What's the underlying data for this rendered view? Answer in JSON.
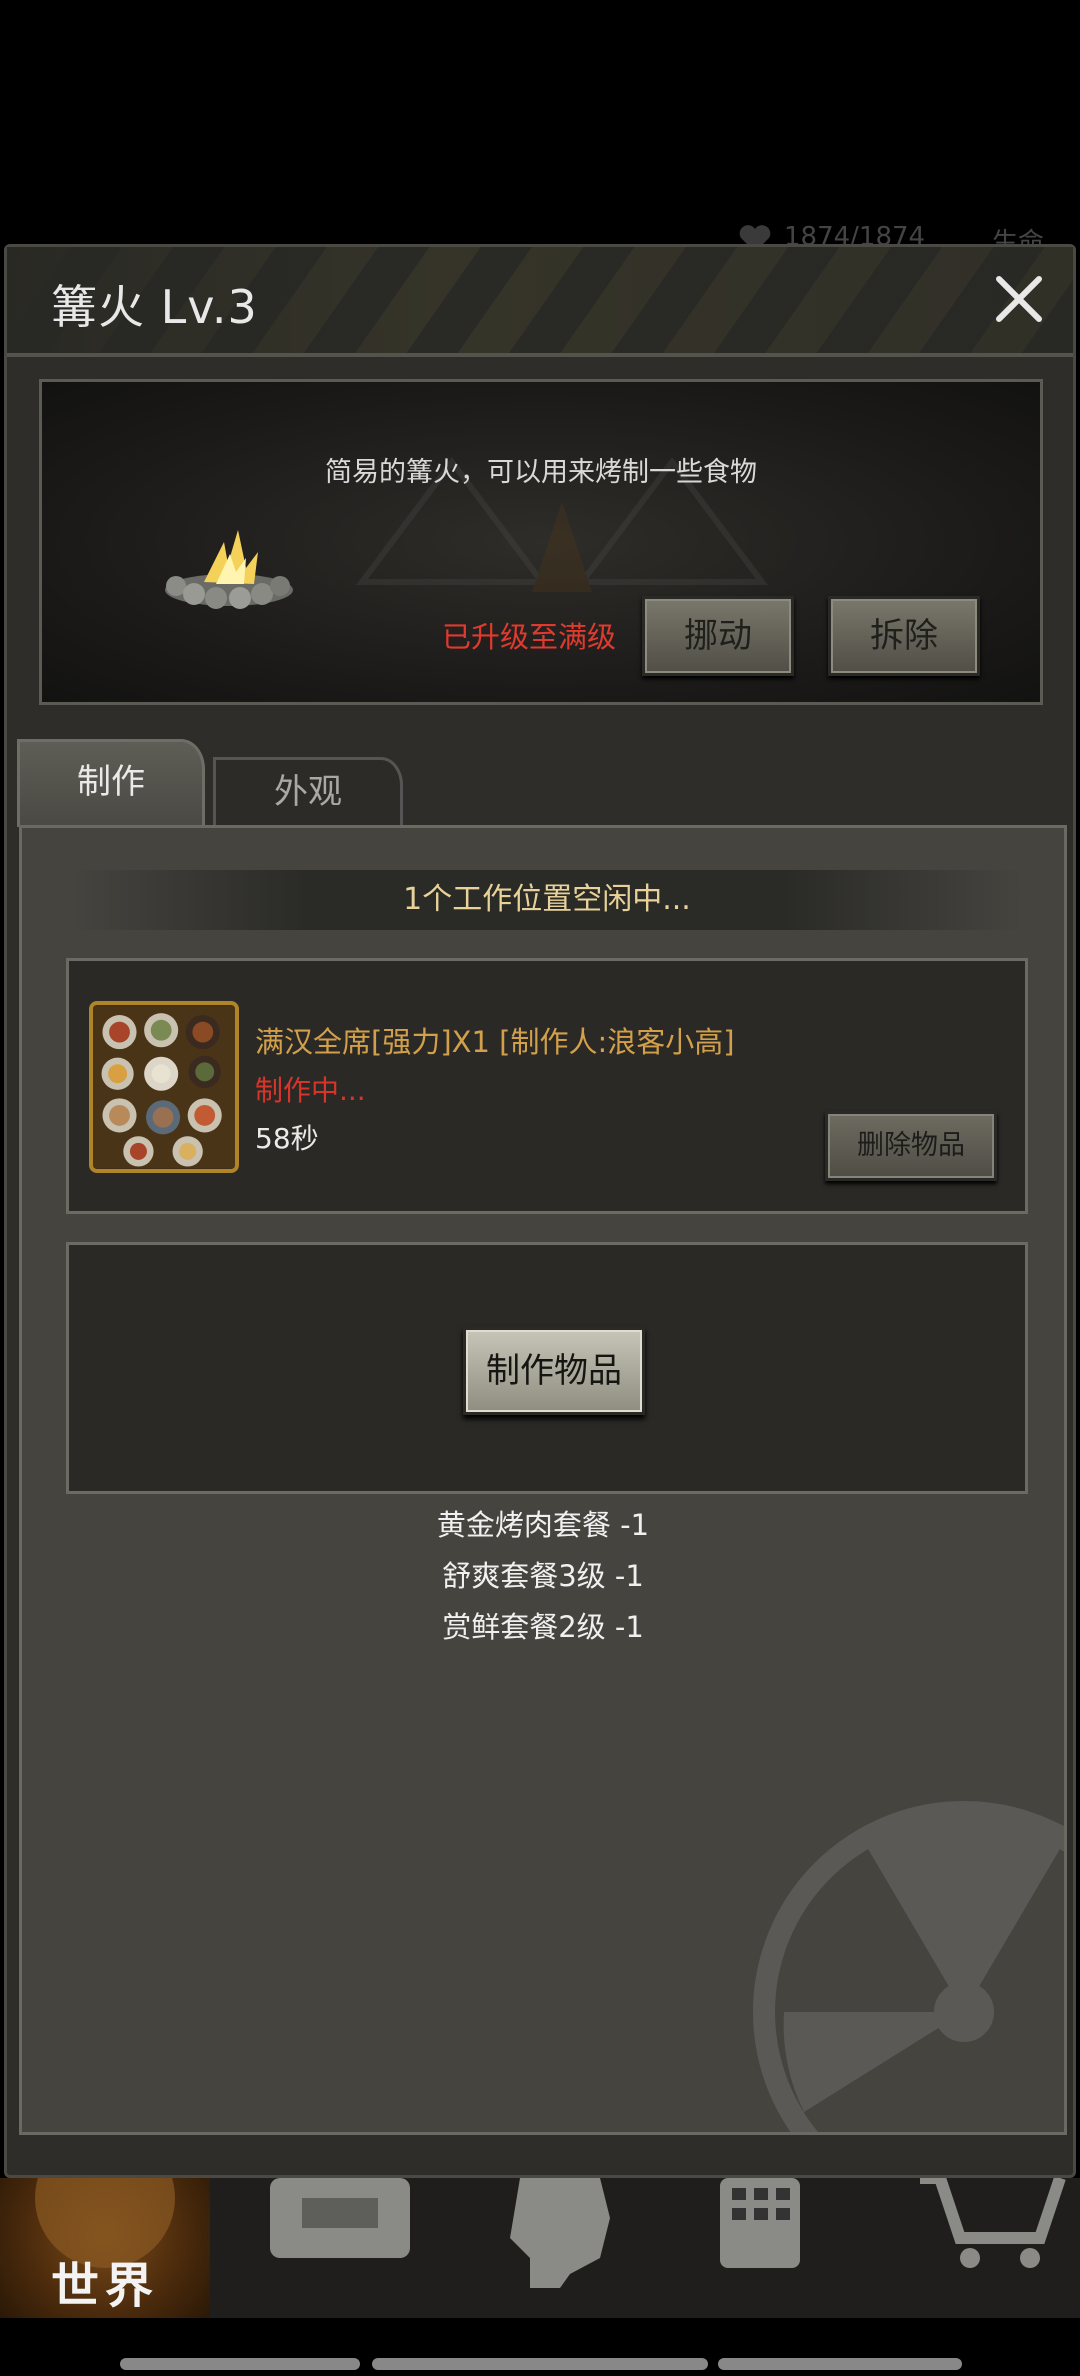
{
  "background_status": {
    "heart_value": "1874/1874",
    "label": "生命"
  },
  "panel": {
    "title": "篝火 Lv.3",
    "description": "简易的篝火，可以用来烤制一些食物",
    "max_level_text": "已升级至满级",
    "move_button": "挪动",
    "demolish_button": "拆除"
  },
  "tabs": [
    {
      "label": "制作",
      "active": true
    },
    {
      "label": "外观",
      "active": false
    }
  ],
  "workshop": {
    "idle_text": "1个工作位置空闲中...",
    "job": {
      "name": "满汉全席[强力]X1 [制作人:浪客小高]",
      "status": "制作中...",
      "time_left": "58秒",
      "delete_button": "删除物品",
      "thumb_icon": "feast-dishes-icon"
    },
    "craft_button": "制作物品",
    "bonuses": [
      "黄金烤肉套餐 -1",
      "舒爽套餐3级 -1",
      "赏鲜套餐2级 -1"
    ]
  },
  "bottom_nav": [
    {
      "label": "世界",
      "icon": "globe-icon"
    },
    {
      "label": "",
      "icon": "backpack-icon"
    },
    {
      "label": "",
      "icon": "character-head-icon"
    },
    {
      "label": "",
      "icon": "phone-icon"
    },
    {
      "label": "",
      "icon": "shopping-cart-icon"
    }
  ],
  "colors": {
    "accent_gold": "#d2a04a",
    "alert_red": "#d9342a",
    "panel_bg": "#2e2d29"
  }
}
